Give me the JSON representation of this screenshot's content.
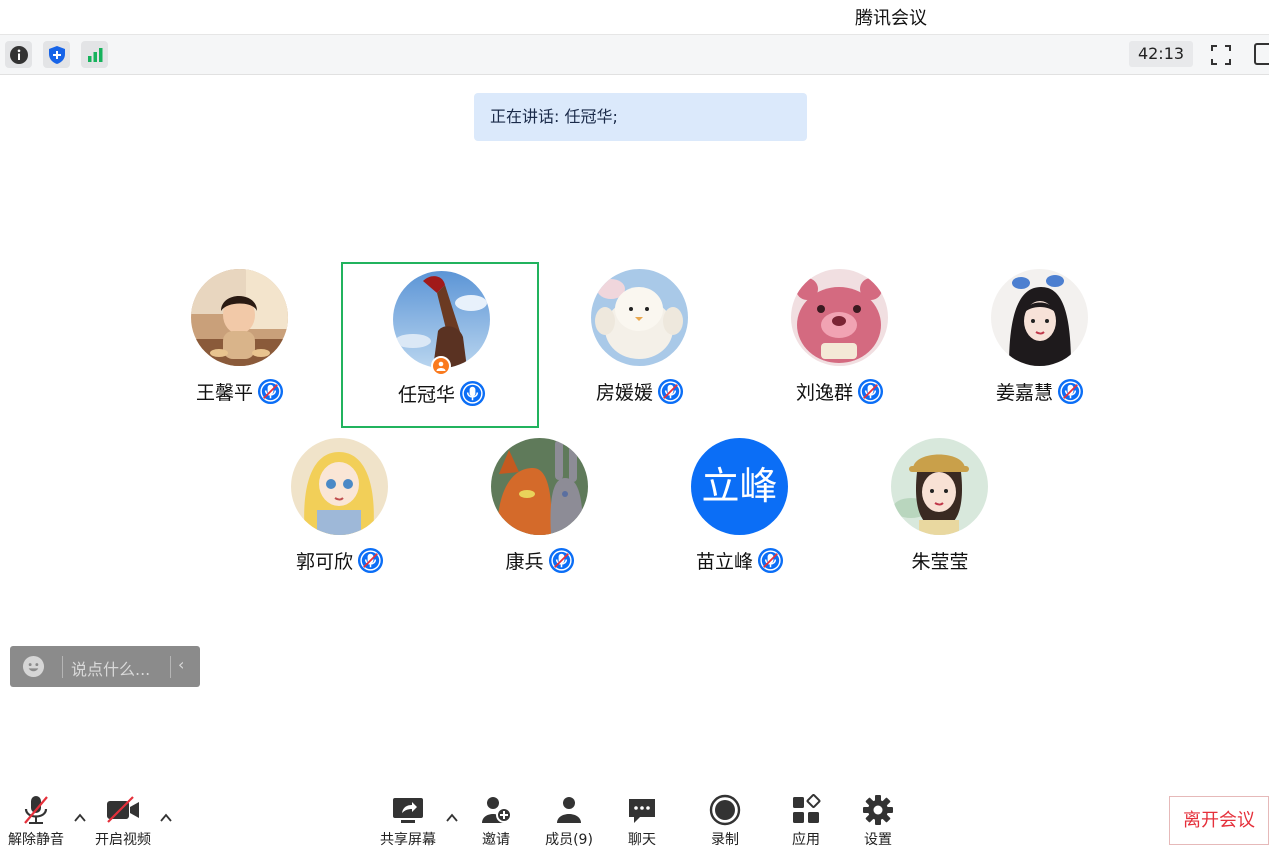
{
  "window": {
    "title": "腾讯会议"
  },
  "topbar": {
    "timer": "42:13"
  },
  "speaking_banner": "正在讲话: 任冠华;",
  "participants": [
    {
      "name": "王馨平",
      "mic": "muted"
    },
    {
      "name": "任冠华",
      "mic": "on",
      "host": true,
      "active_speaker": true
    },
    {
      "name": "房媛媛",
      "mic": "muted"
    },
    {
      "name": "刘逸群",
      "mic": "muted"
    },
    {
      "name": "姜嘉慧",
      "mic": "muted"
    },
    {
      "name": "郭可欣",
      "mic": "muted"
    },
    {
      "name": "康兵",
      "mic": "muted"
    },
    {
      "name": "苗立峰",
      "mic": "muted",
      "avatar_text": "立峰"
    },
    {
      "name": "朱莹莹",
      "mic": "none"
    }
  ],
  "chat": {
    "placeholder": "说点什么..."
  },
  "toolbar": {
    "unmute": "解除静音",
    "start_video": "开启视频",
    "share_screen": "共享屏幕",
    "invite": "邀请",
    "members": "成员(9)",
    "chat": "聊天",
    "record": "录制",
    "apps": "应用",
    "settings": "设置"
  },
  "leave_button": "离开会议",
  "colors": {
    "accent_blue": "#0b6ef6",
    "active_border": "#21b35e",
    "leave_red": "#e5303b",
    "host_badge": "#fa7a1e",
    "signal_green": "#16b25c"
  }
}
